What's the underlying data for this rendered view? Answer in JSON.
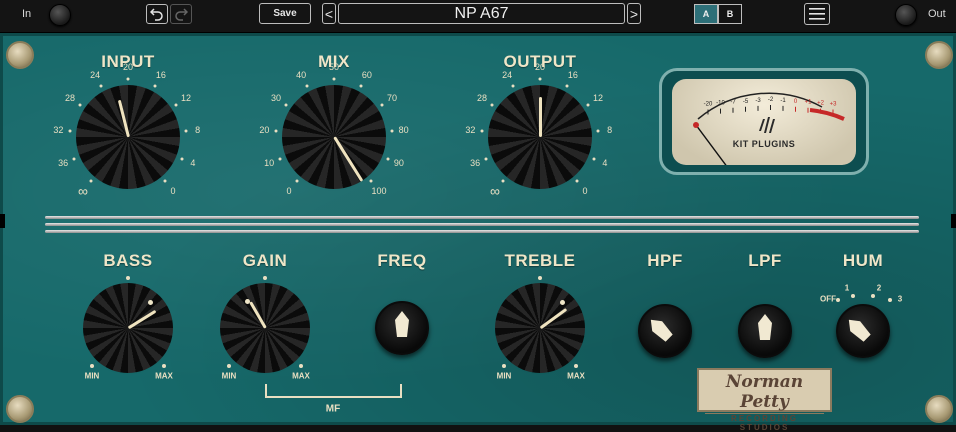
{
  "topbar": {
    "in_label": "In",
    "out_label": "Out",
    "undo_icon": "undo-arrow-icon",
    "redo_icon": "redo-arrow-icon",
    "save_label": "Save",
    "prev_label": "<",
    "next_label": ">",
    "preset_name": "NP A67",
    "a_label": "A",
    "b_label": "B",
    "a_active_color": "#2d6f78",
    "menu_icon": "hamburger-menu-icon"
  },
  "knobs": {
    "input": {
      "label": "INPUT",
      "ticks": [
        "∞",
        "36",
        "32",
        "28",
        "24",
        "20",
        "16",
        "12",
        "8",
        "4",
        "0"
      ]
    },
    "mix": {
      "label": "MIX",
      "ticks": [
        "0",
        "10",
        "20",
        "30",
        "40",
        "50",
        "60",
        "70",
        "80",
        "90",
        "100"
      ]
    },
    "output": {
      "label": "OUTPUT",
      "ticks": [
        "∞",
        "36",
        "32",
        "28",
        "24",
        "20",
        "16",
        "12",
        "8",
        "4",
        "0"
      ]
    },
    "bass": {
      "label": "BASS",
      "min": "MIN",
      "max": "MAX"
    },
    "gain": {
      "label": "GAIN",
      "min": "MIN",
      "max": "MAX"
    },
    "freq": {
      "label": "FREQ"
    },
    "treble": {
      "label": "TREBLE",
      "min": "MIN",
      "max": "MAX"
    },
    "hpf": {
      "label": "HPF"
    },
    "lpf": {
      "label": "LPF"
    },
    "hum": {
      "label": "HUM",
      "ticks": [
        "OFF",
        "1",
        "2",
        "3"
      ]
    }
  },
  "mf_label": "MF",
  "vu": {
    "scale": [
      "-20",
      "-10",
      "-7",
      "-5",
      "-3",
      "-2",
      "-1",
      "0",
      "+1",
      "+2",
      "+3"
    ],
    "brand": "KIT PLUGINS"
  },
  "signature": {
    "line1": "Norman Petty",
    "line2": "RECORDING STUDIOS"
  },
  "colors": {
    "panel": "#16696a",
    "text": "#efe6c8",
    "vu_red": "#c62828"
  }
}
